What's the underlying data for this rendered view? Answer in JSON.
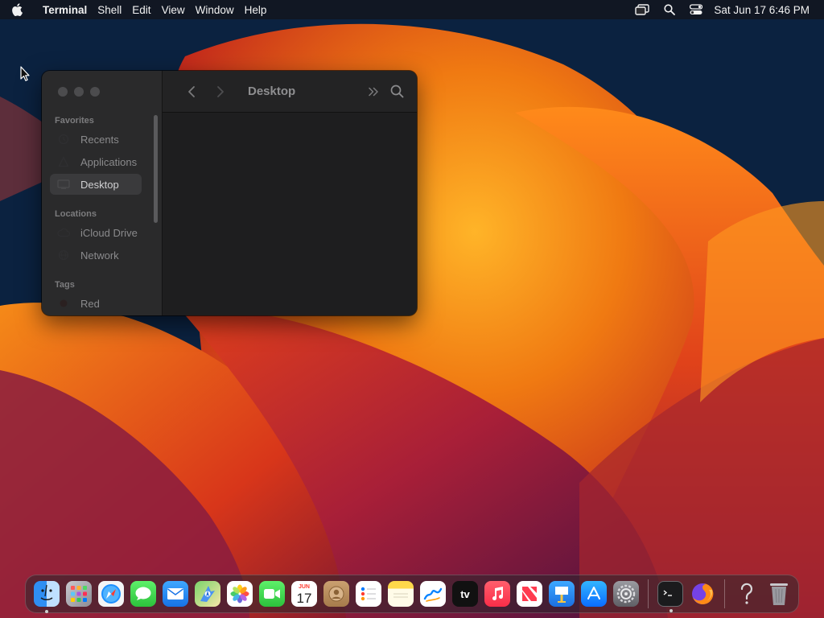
{
  "menubar": {
    "app_name": "Terminal",
    "items": [
      "Shell",
      "Edit",
      "View",
      "Window",
      "Help"
    ],
    "clock": "Sat Jun 17  6:46 PM",
    "status_icons": [
      "screen-mirroring-icon",
      "spotlight-search-icon",
      "control-center-icon"
    ]
  },
  "finder": {
    "title": "Desktop",
    "sidebar": {
      "favorites_label": "Favorites",
      "favorites": [
        {
          "label": "Recents",
          "icon": "clock-icon",
          "selected": false
        },
        {
          "label": "Applications",
          "icon": "applications-icon",
          "selected": false
        },
        {
          "label": "Desktop",
          "icon": "desktop-icon",
          "selected": true
        }
      ],
      "locations_label": "Locations",
      "locations": [
        {
          "label": "iCloud Drive",
          "icon": "cloud-icon"
        },
        {
          "label": "Network",
          "icon": "network-icon"
        }
      ],
      "tags_label": "Tags",
      "tags": [
        {
          "label": "Red",
          "icon": "tag-dot-icon"
        }
      ]
    }
  },
  "dock": {
    "calendar": {
      "month": "JUN",
      "day": "17"
    },
    "tv_label": "tv",
    "apps": [
      {
        "name": "Finder",
        "icon": "finder-icon",
        "running": true
      },
      {
        "name": "Launchpad",
        "icon": "launchpad-icon"
      },
      {
        "name": "Safari",
        "icon": "safari-icon"
      },
      {
        "name": "Messages",
        "icon": "messages-icon"
      },
      {
        "name": "Mail",
        "icon": "mail-icon"
      },
      {
        "name": "Maps",
        "icon": "maps-icon"
      },
      {
        "name": "Photos",
        "icon": "photos-icon"
      },
      {
        "name": "FaceTime",
        "icon": "facetime-icon"
      },
      {
        "name": "Calendar",
        "icon": "calendar-icon"
      },
      {
        "name": "Contacts",
        "icon": "contacts-icon"
      },
      {
        "name": "Reminders",
        "icon": "reminders-icon"
      },
      {
        "name": "Notes",
        "icon": "notes-icon"
      },
      {
        "name": "Freeform",
        "icon": "freeform-icon"
      },
      {
        "name": "TV",
        "icon": "appletv-icon"
      },
      {
        "name": "Music",
        "icon": "music-icon"
      },
      {
        "name": "News",
        "icon": "news-icon"
      },
      {
        "name": "Keynote",
        "icon": "keynote-icon"
      },
      {
        "name": "App Store",
        "icon": "appstore-icon"
      },
      {
        "name": "System Settings",
        "icon": "settings-gear-icon"
      },
      {
        "name": "Terminal",
        "icon": "terminal-icon",
        "running": true
      },
      {
        "name": "Firefox",
        "icon": "firefox-icon"
      },
      {
        "name": "Help",
        "icon": "question-mark-icon"
      },
      {
        "name": "Trash",
        "icon": "trash-icon"
      }
    ]
  },
  "colors": {
    "wallpaper_orange": "#f07a12",
    "wallpaper_red": "#c42a1c",
    "wallpaper_purple": "#6a1a48",
    "wallpaper_navy": "#0b2240",
    "window_bg": "#1e1e1f",
    "sidebar_bg": "#2a2a2b"
  }
}
